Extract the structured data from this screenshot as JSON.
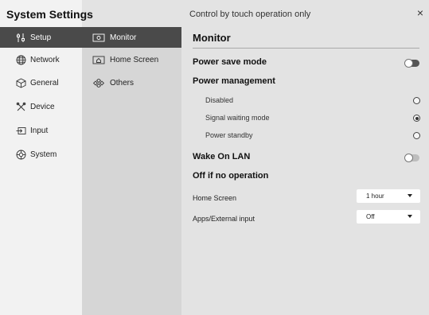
{
  "app": {
    "title": "System Settings"
  },
  "header": {
    "notice": "Control by touch operation only",
    "close_glyph": "×"
  },
  "nav": {
    "items": [
      {
        "label": "Setup",
        "icon": "setup-icon",
        "active": true
      },
      {
        "label": "Network",
        "icon": "globe-icon",
        "active": false
      },
      {
        "label": "General",
        "icon": "cube-icon",
        "active": false
      },
      {
        "label": "Device",
        "icon": "tools-icon",
        "active": false
      },
      {
        "label": "Input",
        "icon": "input-icon",
        "active": false
      },
      {
        "label": "System",
        "icon": "system-icon",
        "active": false
      }
    ]
  },
  "subnav": {
    "items": [
      {
        "label": "Monitor",
        "icon": "monitor-icon",
        "active": true
      },
      {
        "label": "Home Screen",
        "icon": "home-screen-icon",
        "active": false
      },
      {
        "label": "Others",
        "icon": "others-icon",
        "active": false
      }
    ]
  },
  "main": {
    "title": "Monitor",
    "power_save": {
      "label": "Power save mode",
      "on": true
    },
    "power_management": {
      "label": "Power management",
      "options": [
        {
          "label": "Disabled",
          "selected": false
        },
        {
          "label": "Signal waiting mode",
          "selected": true
        },
        {
          "label": "Power standby",
          "selected": false
        }
      ]
    },
    "wake_on_lan": {
      "label": "Wake On LAN",
      "on": false
    },
    "off_if_no_operation": {
      "label": "Off if no operation",
      "home_screen": {
        "label": "Home Screen",
        "value": "1 hour"
      },
      "apps_external": {
        "label": "Apps/External input",
        "value": "Off"
      }
    }
  }
}
